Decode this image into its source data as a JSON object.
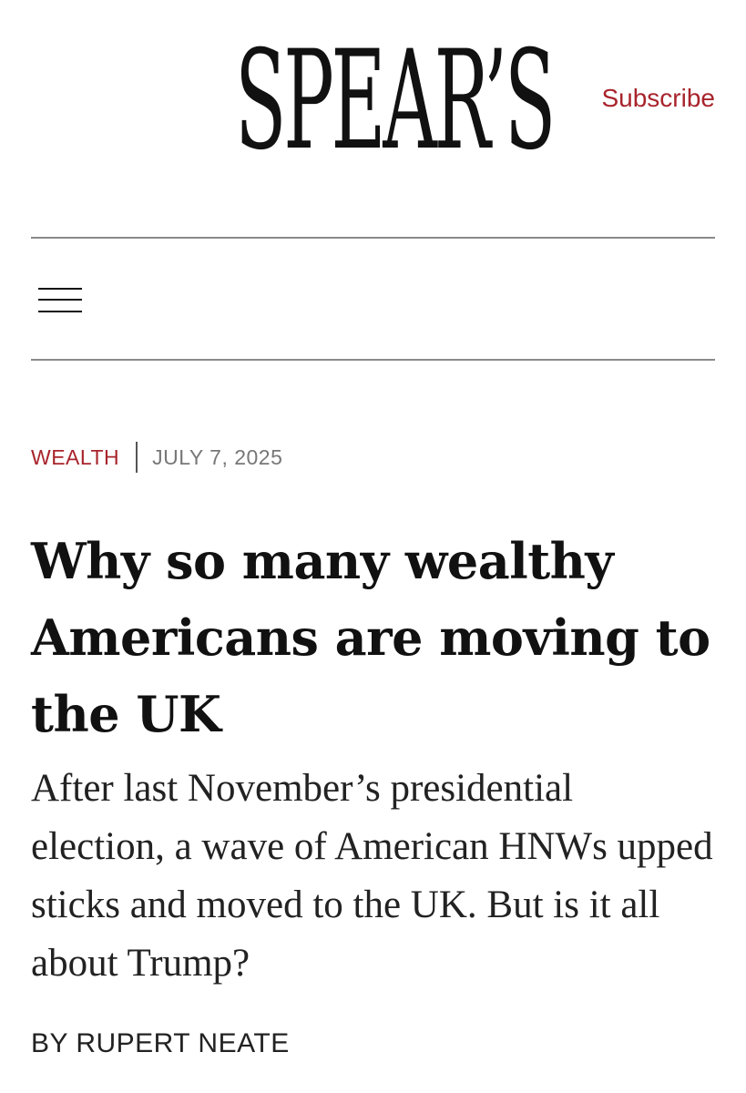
{
  "header": {
    "logo_text": "SPEAR’S",
    "subscribe_label": "Subscribe",
    "menu_icon": "hamburger-menu-icon"
  },
  "article": {
    "category": "WEALTH",
    "date": "JULY 7, 2025",
    "headline": "Why so many wealthy Americans are moving to the UK",
    "standfirst": "After last November’s presidential election, a wave of American HNWs upped sticks and moved to the UK. But is it all about Trump?",
    "byline_prefix": "BY",
    "author": "RUPERT NEATE"
  },
  "colors": {
    "accent": "#a8242c",
    "text": "#111111",
    "muted": "#777777",
    "rule": "#8a8a8a"
  }
}
